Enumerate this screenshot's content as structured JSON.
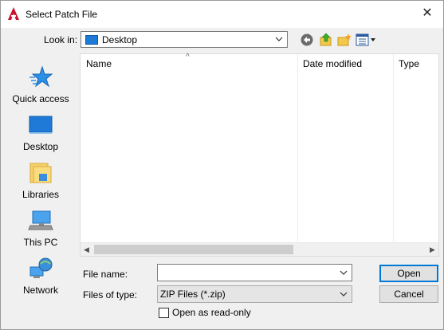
{
  "window": {
    "title": "Select Patch File",
    "close_glyph": "✕",
    "app_icon": "autocad-a-icon"
  },
  "look_in": {
    "label": "Look in:",
    "value": "Desktop",
    "folder_icon": "desktop-folder-icon"
  },
  "toolbar": {
    "icons": [
      "back-arrow-icon",
      "up-one-level-icon",
      "create-new-folder-icon",
      "view-menu-icon"
    ]
  },
  "places": [
    {
      "label": "Quick access",
      "icon": "quick-access-star-icon"
    },
    {
      "label": "Desktop",
      "icon": "desktop-icon"
    },
    {
      "label": "Libraries",
      "icon": "libraries-icon"
    },
    {
      "label": "This PC",
      "icon": "this-pc-icon"
    },
    {
      "label": "Network",
      "icon": "network-icon"
    }
  ],
  "file_list": {
    "columns": [
      "Name",
      "Date modified",
      "Type"
    ],
    "sort_indicator": "^",
    "items": []
  },
  "form": {
    "file_name_label": "File name:",
    "file_name_value": "",
    "file_type_label": "Files of type:",
    "file_type_value": "ZIP Files (*.zip)",
    "read_only_label": "Open as read-only",
    "read_only_checked": false
  },
  "buttons": {
    "open": "Open",
    "cancel": "Cancel"
  },
  "colors": {
    "accent": "#0078d7",
    "app_logo_red": "#c8102e",
    "desktop_blue": "#1e7ad6"
  }
}
